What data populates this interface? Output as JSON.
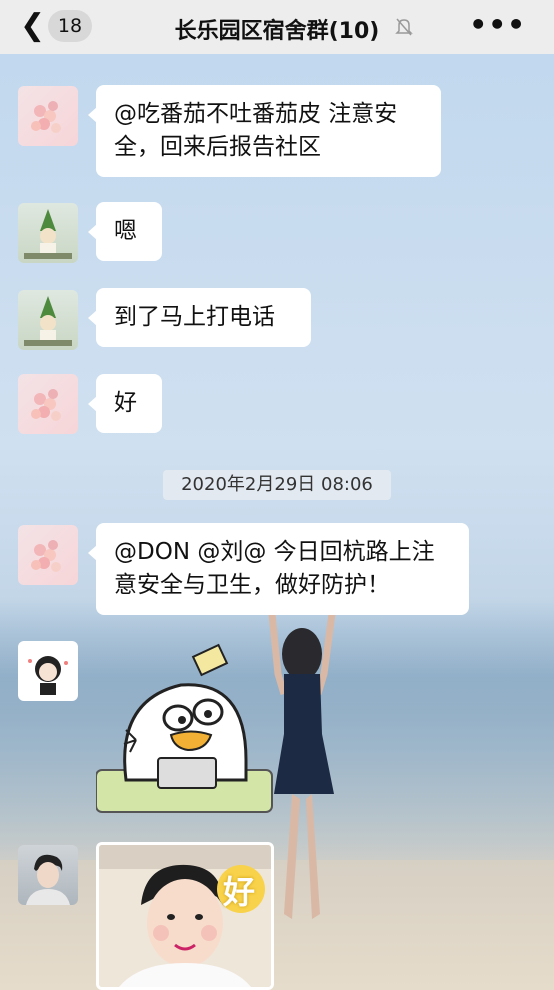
{
  "header": {
    "back_icon": "chevron-left-icon",
    "unread_count": "18",
    "title": "长乐园区宿舍群(10)",
    "mute_icon": "bell-slash-icon",
    "more_icon": "more-icon"
  },
  "messages": [
    {
      "avatar": "pink-flowers-avatar",
      "text_line1": "@吃番茄不吐番茄皮 注意安",
      "text_line2": "全，回来后报告社区"
    },
    {
      "avatar": "gnome-avatar",
      "text": "嗯"
    },
    {
      "avatar": "gnome-avatar",
      "text": "到了马上打电话"
    },
    {
      "avatar": "pink-flowers-avatar",
      "text": "好"
    },
    {
      "avatar": "pink-flowers-avatar",
      "text_line1": "@DON @刘@ 今日回杭路上注",
      "text_line2": "意安全与卫生，做好防护！"
    },
    {
      "avatar": "girl-cartoon-avatar",
      "sticker": "duck-sticker-with-laptop"
    },
    {
      "avatar": "young-man-avatar",
      "image": "boy-photo",
      "photo_text": "好"
    }
  ],
  "timestamp": "2020年2月29日 08:06",
  "colors": {
    "header_bg": "#ededed",
    "bubble_bg": "#ffffff",
    "text": "#111111"
  }
}
